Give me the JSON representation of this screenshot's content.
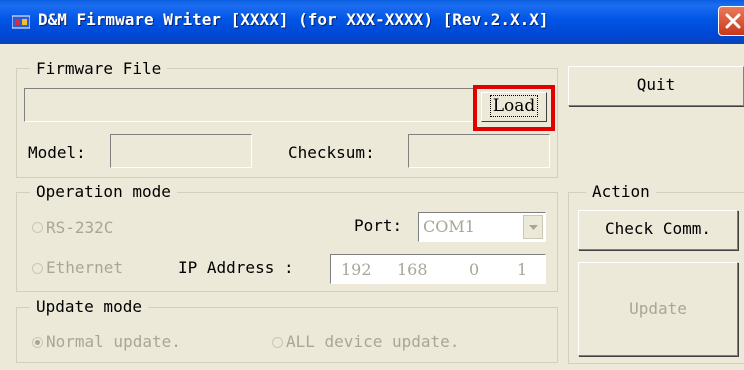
{
  "window": {
    "title": "D&M Firmware Writer [XXXX] (for XXX-XXXX) [Rev.2.X.X]",
    "close_icon": "close-icon",
    "app_icon": "app-icon"
  },
  "firmware_file": {
    "group_label": "Firmware File",
    "path_value": "",
    "load_label": "Load",
    "model_label": "Model:",
    "model_value": "",
    "checksum_label": "Checksum:",
    "checksum_value": ""
  },
  "operation_mode": {
    "group_label": "Operation mode",
    "rs232c_label": "RS-232C",
    "port_label": "Port:",
    "port_value": "COM1",
    "ethernet_label": "Ethernet",
    "ip_label": "IP Address :",
    "ip_octets": [
      "192",
      "168",
      "0",
      "1"
    ]
  },
  "update_mode": {
    "group_label": "Update mode",
    "normal_label": "Normal update.",
    "all_label": "ALL device update.",
    "selected": "normal"
  },
  "action": {
    "group_label": "Action",
    "check_comm_label": "Check Comm.",
    "update_label": "Update"
  },
  "quit_label": "Quit",
  "colors": {
    "highlight": "#E00000",
    "titlebar": "#0055E5",
    "window_bg": "#ECE9D8"
  }
}
